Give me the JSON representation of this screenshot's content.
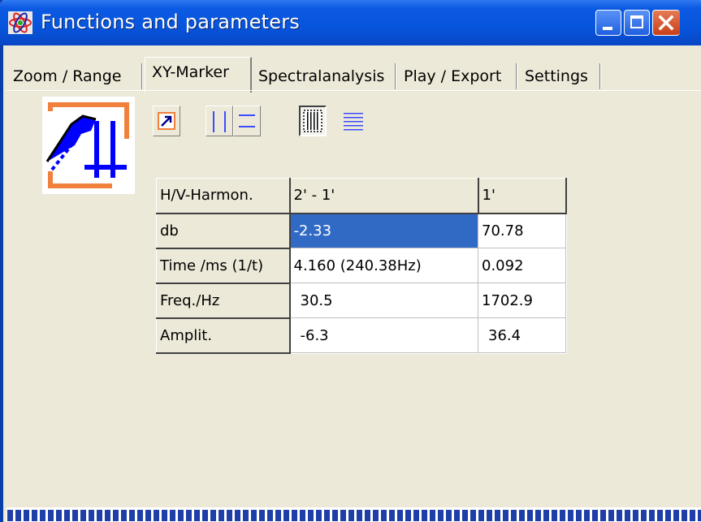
{
  "window": {
    "title": "Functions and parameters"
  },
  "icons": {
    "app": "atom-icon",
    "minimize": "minimize-icon",
    "maximize": "maximize-icon",
    "close": "close-icon"
  },
  "tabs": [
    {
      "label": "Zoom / Range",
      "active": false
    },
    {
      "label": "XY-Marker",
      "active": true
    },
    {
      "label": "Spectralanalysis",
      "active": false
    },
    {
      "label": "Play / Export",
      "active": false
    },
    {
      "label": "Settings",
      "active": false
    }
  ],
  "toolbar": {
    "buttons": [
      {
        "icon": "arrow-icon",
        "pressed": false
      },
      {
        "icon": "vertical-markers-icon",
        "pressed": false
      },
      {
        "icon": "horizontal-markers-icon",
        "pressed": false
      },
      {
        "icon": "vertical-harmonic-markers-icon",
        "pressed": true
      },
      {
        "icon": "horizontal-harmonic-markers-icon",
        "pressed": false
      }
    ]
  },
  "table": {
    "header": [
      "H/V-Harmon.",
      "2' - 1'",
      "1'"
    ],
    "rows": [
      {
        "label": "db",
        "values": [
          "-2.33",
          "70.78"
        ],
        "selected_col": 0
      },
      {
        "label": "Time /ms (1/t)",
        "values": [
          "4.160 (240.38Hz)",
          "0.092"
        ]
      },
      {
        "label": "Freq./Hz",
        "values": [
          "30.5",
          "1702.9"
        ]
      },
      {
        "label": "Amplit.",
        "values": [
          "-6.3",
          "36.4"
        ]
      }
    ]
  },
  "colors": {
    "titlebar": "#0754dc",
    "accent_icon": "#0000ff",
    "accent_orange": "#f0803c",
    "selection": "#316ac5",
    "progress": "#1f3fa8"
  }
}
